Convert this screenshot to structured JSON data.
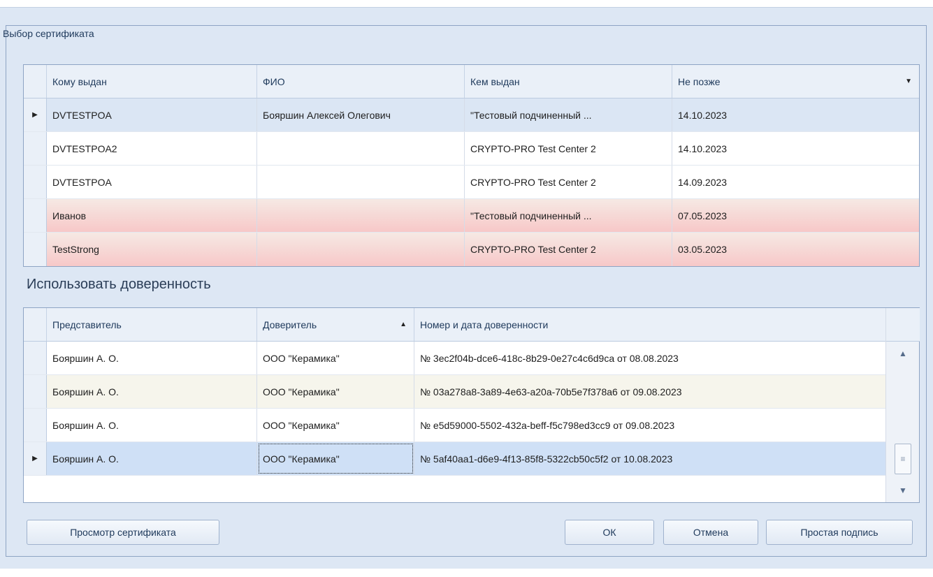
{
  "dialog": {
    "caption": "Выбор сертификата",
    "poa_section_title": "Использовать доверенность"
  },
  "cert_grid": {
    "headers": [
      "Кому выдан",
      "ФИО",
      "Кем выдан",
      "Не позже"
    ],
    "rows": [
      [
        "DVTESTPOA",
        "Бояршин Алексей Олегович",
        "\"Тестовый подчиненный ...",
        "14.10.2023"
      ],
      [
        "DVTESTPOA2",
        "",
        "CRYPTO-PRO Test Center 2",
        "14.10.2023"
      ],
      [
        "DVTESTPOA",
        "",
        "CRYPTO-PRO Test Center 2",
        "14.09.2023"
      ],
      [
        "Иванов",
        "",
        "\"Тестовый подчиненный ...",
        "07.05.2023"
      ],
      [
        "TestStrong",
        "",
        "CRYPTO-PRO Test Center 2",
        "03.05.2023"
      ]
    ]
  },
  "poa_grid": {
    "headers": [
      "Представитель",
      "Доверитель",
      "Номер и дата доверенности"
    ],
    "rows": [
      [
        "Бояршин А. О.",
        "ООО \"Керамика\"",
        "№ 3ec2f04b-dce6-418c-8b29-0e27c4c6d9ca от 08.08.2023"
      ],
      [
        "Бояршин А. О.",
        "ООО \"Керамика\"",
        "№ 03a278a8-3a89-4e63-a20a-70b5e7f378a6 от 09.08.2023"
      ],
      [
        "Бояршин А. О.",
        "ООО \"Керамика\"",
        "№ e5d59000-5502-432a-beff-f5c798ed3cc9 от 09.08.2023"
      ],
      [
        "Бояршин А. О.",
        "ООО \"Керамика\"",
        "№ 5af40aa1-d6e9-4f13-85f8-5322cb50c5f2 от 10.08.2023"
      ]
    ]
  },
  "buttons": {
    "view_cert": "Просмотр сертификата",
    "ok": "ОК",
    "cancel": "Отмена",
    "simple_sign": "Простая подпись"
  }
}
